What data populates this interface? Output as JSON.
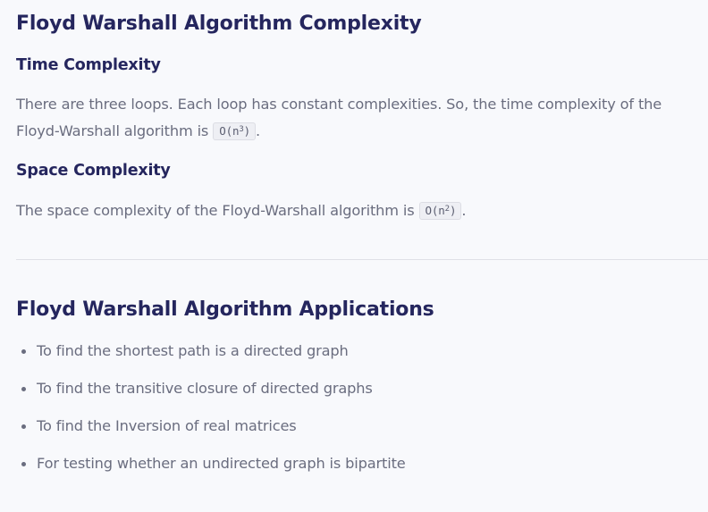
{
  "complexity_section": {
    "title": "Floyd Warshall Algorithm Complexity",
    "time": {
      "heading": "Time Complexity",
      "text_before": "There are three loops. Each loop has constant complexities. So, the time complexity of the Floyd-Warshall algorithm is ",
      "code_base": "O(n",
      "code_exp": "3",
      "code_close": ")",
      "text_after": "."
    },
    "space": {
      "heading": "Space Complexity",
      "text_before": "The space complexity of the Floyd-Warshall algorithm is ",
      "code_base": "O(n",
      "code_exp": "2",
      "code_close": ")",
      "text_after": "."
    }
  },
  "applications_section": {
    "title": "Floyd Warshall Algorithm Applications",
    "items": [
      "To find the shortest path is a directed graph",
      "To find the transitive closure of directed graphs",
      "To find the Inversion of real matrices",
      "For testing whether an undirected graph is bipartite"
    ]
  }
}
